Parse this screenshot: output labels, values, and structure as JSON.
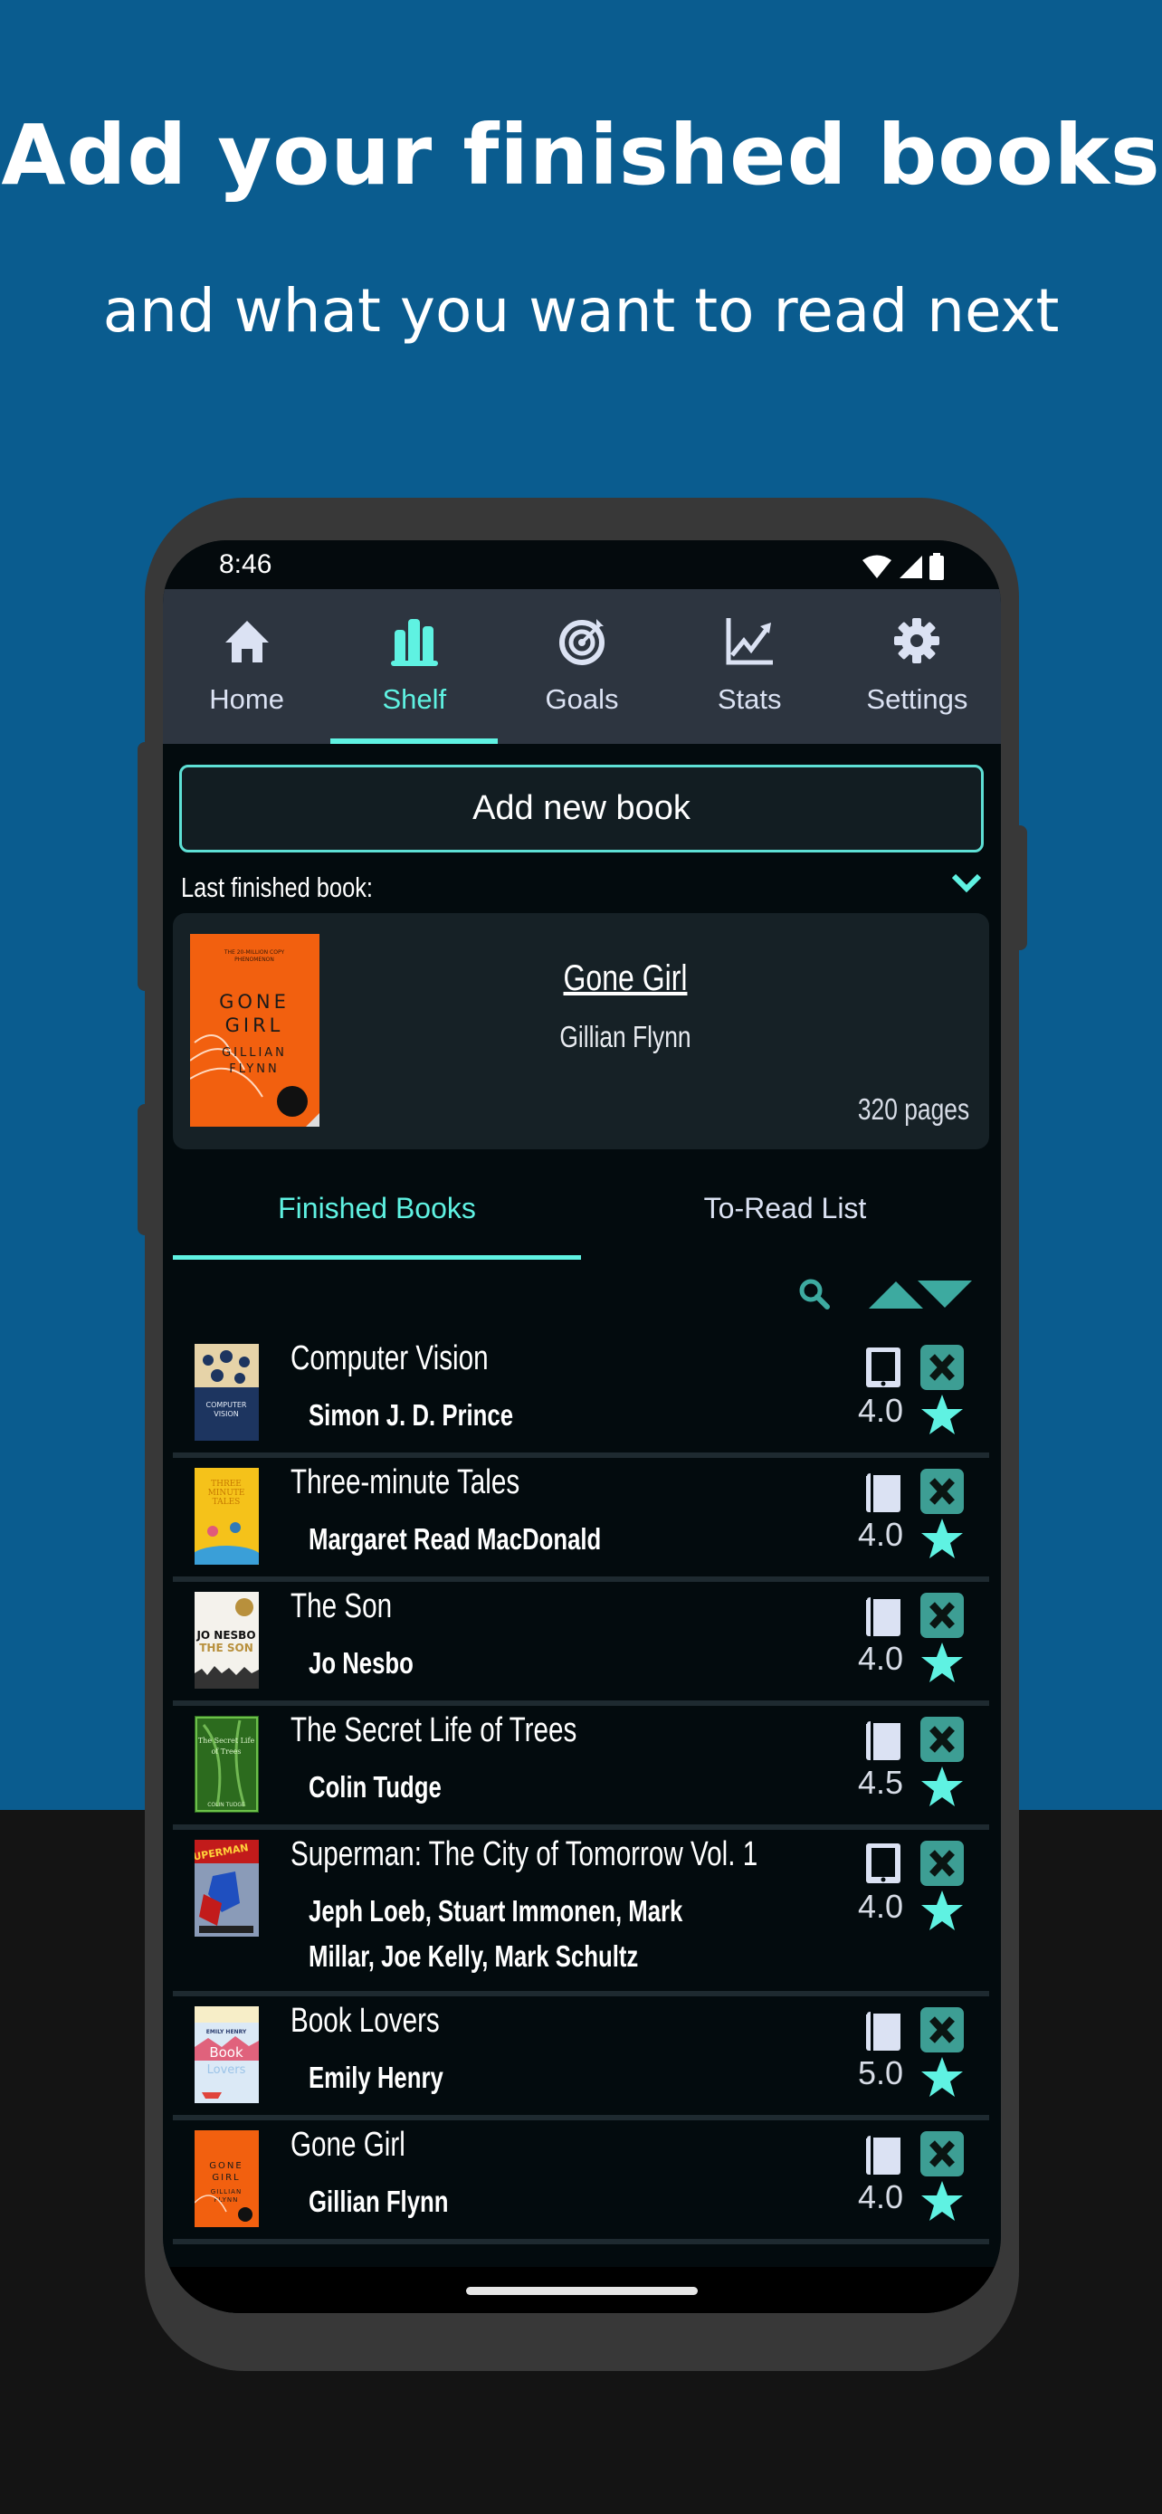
{
  "promo": {
    "headline": "Add your finished books",
    "subline": "and what you want to read next"
  },
  "colors": {
    "accent": "#5ff2e2",
    "accent_muted": "#3d9e94",
    "background_blue": "#0a5c8f",
    "nav_background": "#2d3540",
    "screen_background": "#030b0e"
  },
  "status_bar": {
    "time": "8:46",
    "icons": [
      "wifi-icon",
      "signal-icon",
      "battery-icon"
    ]
  },
  "nav": {
    "items": [
      {
        "label": "Home",
        "icon": "home-icon",
        "active": false
      },
      {
        "label": "Shelf",
        "icon": "bookshelf-icon",
        "active": true
      },
      {
        "label": "Goals",
        "icon": "target-icon",
        "active": false
      },
      {
        "label": "Stats",
        "icon": "chart-line-icon",
        "active": false
      },
      {
        "label": "Settings",
        "icon": "gear-icon",
        "active": false
      }
    ]
  },
  "add_book_button": "Add new book",
  "last_finished": {
    "label": "Last finished book:",
    "title": "Gone Girl",
    "author": "Gillian Flynn",
    "pages": "320 pages",
    "cover": "gone-girl-cover"
  },
  "tabs": [
    {
      "label": "Finished Books",
      "active": true
    },
    {
      "label": "To-Read List",
      "active": false
    }
  ],
  "tools": {
    "search": "search-icon",
    "sort": "sort-asc-desc-icon"
  },
  "books": [
    {
      "title": "Computer Vision",
      "author": "Simon J. D. Prince",
      "rating": "4.0",
      "format": "ebook",
      "cover": "computer-vision"
    },
    {
      "title": "Three-minute Tales",
      "author": "Margaret Read MacDonald",
      "rating": "4.0",
      "format": "paper",
      "cover": "three-minute-tales"
    },
    {
      "title": "The Son",
      "author": "Jo Nesbo",
      "rating": "4.0",
      "format": "paper",
      "cover": "the-son"
    },
    {
      "title": "The Secret Life of Trees",
      "author": "Colin Tudge",
      "rating": "4.5",
      "format": "paper",
      "cover": "secret-life-of-trees"
    },
    {
      "title": "Superman: The City of Tomorrow Vol. 1",
      "author": "Jeph Loeb, Stuart Immonen, Mark Millar, Joe Kelly, Mark Schultz",
      "rating": "4.0",
      "format": "ebook",
      "cover": "superman"
    },
    {
      "title": "Book Lovers",
      "author": "Emily Henry",
      "rating": "5.0",
      "format": "paper",
      "cover": "book-lovers"
    },
    {
      "title": "Gone Girl",
      "author": "Gillian Flynn",
      "rating": "4.0",
      "format": "paper",
      "cover": "gone-girl"
    }
  ]
}
